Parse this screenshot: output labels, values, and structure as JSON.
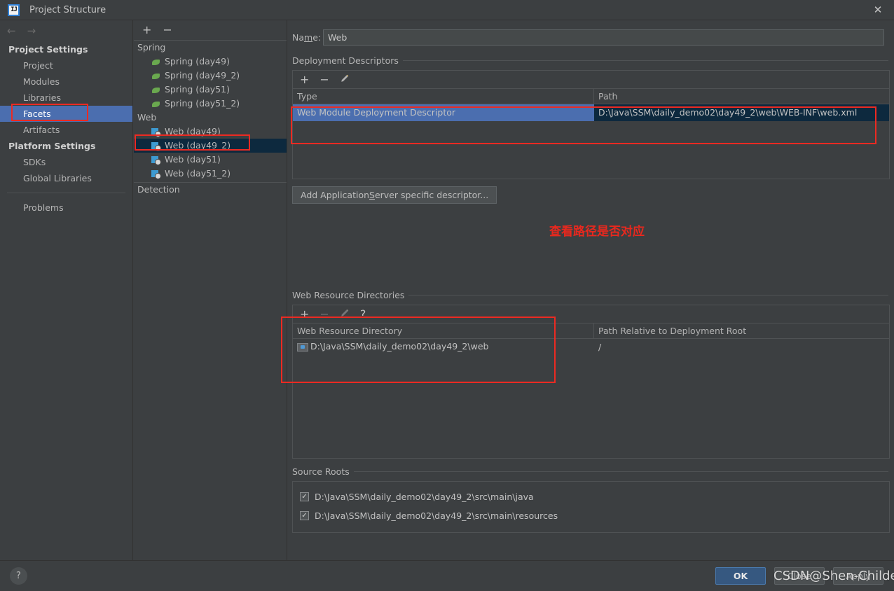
{
  "window": {
    "title": "Project Structure",
    "logo_text": "IJ",
    "close_icon": "✕"
  },
  "nav": {
    "back_icon": "←",
    "forward_icon": "→"
  },
  "sidebar": {
    "groups": [
      {
        "title": "Project Settings",
        "items": [
          {
            "label": "Project",
            "selected": false
          },
          {
            "label": "Modules",
            "selected": false
          },
          {
            "label": "Libraries",
            "selected": false
          },
          {
            "label": "Facets",
            "selected": true
          },
          {
            "label": "Artifacts",
            "selected": false
          }
        ]
      },
      {
        "title": "Platform Settings",
        "items": [
          {
            "label": "SDKs",
            "selected": false
          },
          {
            "label": "Global Libraries",
            "selected": false
          }
        ]
      }
    ],
    "problems": {
      "label": "Problems"
    }
  },
  "facet_tree": {
    "toolbar": {
      "add_icon": "+",
      "remove_icon": "−"
    },
    "categories": [
      {
        "name": "Spring",
        "items": [
          {
            "label": "Spring (day49)",
            "icon": "spring-leaf-icon",
            "selected": false
          },
          {
            "label": "Spring (day49_2)",
            "icon": "spring-leaf-icon",
            "selected": false
          },
          {
            "label": "Spring (day51)",
            "icon": "spring-leaf-icon",
            "selected": false
          },
          {
            "label": "Spring (day51_2)",
            "icon": "spring-leaf-icon",
            "selected": false
          }
        ]
      },
      {
        "name": "Web",
        "items": [
          {
            "label": "Web (day49)",
            "icon": "web-facet-icon",
            "selected": false
          },
          {
            "label": "Web (day49_2)",
            "icon": "web-facet-icon",
            "selected": true
          },
          {
            "label": "Web (day51)",
            "icon": "web-facet-icon",
            "selected": false
          },
          {
            "label": "Web (day51_2)",
            "icon": "web-facet-icon",
            "selected": false
          }
        ]
      }
    ],
    "detection_label": "Detection"
  },
  "facet_form": {
    "name_label_pre": "Na",
    "name_label_mnemonic": "m",
    "name_label_post": "e:",
    "name_value": "Web",
    "deployment_descriptors": {
      "title": "Deployment Descriptors",
      "toolbar": {
        "add_icon": "+",
        "remove_icon": "−",
        "edit_icon": "edit-pencil-icon"
      },
      "columns": [
        "Type",
        "Path"
      ],
      "rows": [
        {
          "type": "Web Module Deployment Descriptor",
          "path": "D:\\Java\\SSM\\daily_demo02\\day49_2\\web\\WEB-INF\\web.xml",
          "selected": true
        }
      ],
      "add_server_descriptor_pre": "Add Application ",
      "add_server_descriptor_mnemonic": "S",
      "add_server_descriptor_post": "erver specific descriptor..."
    },
    "web_resource_directories": {
      "title": "Web Resource Directories",
      "toolbar": {
        "add_icon": "+",
        "remove_icon": "−",
        "edit_icon": "edit-pencil-icon",
        "help_icon": "?"
      },
      "columns": [
        "Web Resource Directory",
        "Path Relative to Deployment Root"
      ],
      "rows": [
        {
          "directory": "D:\\Java\\SSM\\daily_demo02\\day49_2\\web",
          "relative_path": "/"
        }
      ]
    },
    "source_roots": {
      "title": "Source Roots",
      "items": [
        {
          "path": "D:\\Java\\SSM\\daily_demo02\\day49_2\\src\\main\\java",
          "checked": true,
          "check_glyph": "✓"
        },
        {
          "path": "D:\\Java\\SSM\\daily_demo02\\day49_2\\src\\main\\resources",
          "checked": true,
          "check_glyph": "✓"
        }
      ]
    }
  },
  "footer": {
    "help_icon": "?",
    "ok_label": "OK",
    "close_label": "Close",
    "apply_label": "Apply"
  },
  "annotations": {
    "note_text": "查看路径是否对应",
    "accent_color": "#ec2a22",
    "watermark": "CSDN@Shen-Childe"
  },
  "colors": {
    "background": "#3c3f41",
    "selection_blue": "#4b6eaf",
    "selection_dark": "#0d293e",
    "primary_button": "#365880",
    "spring_green": "#6aa84f",
    "web_blue": "#3d9ad1"
  }
}
